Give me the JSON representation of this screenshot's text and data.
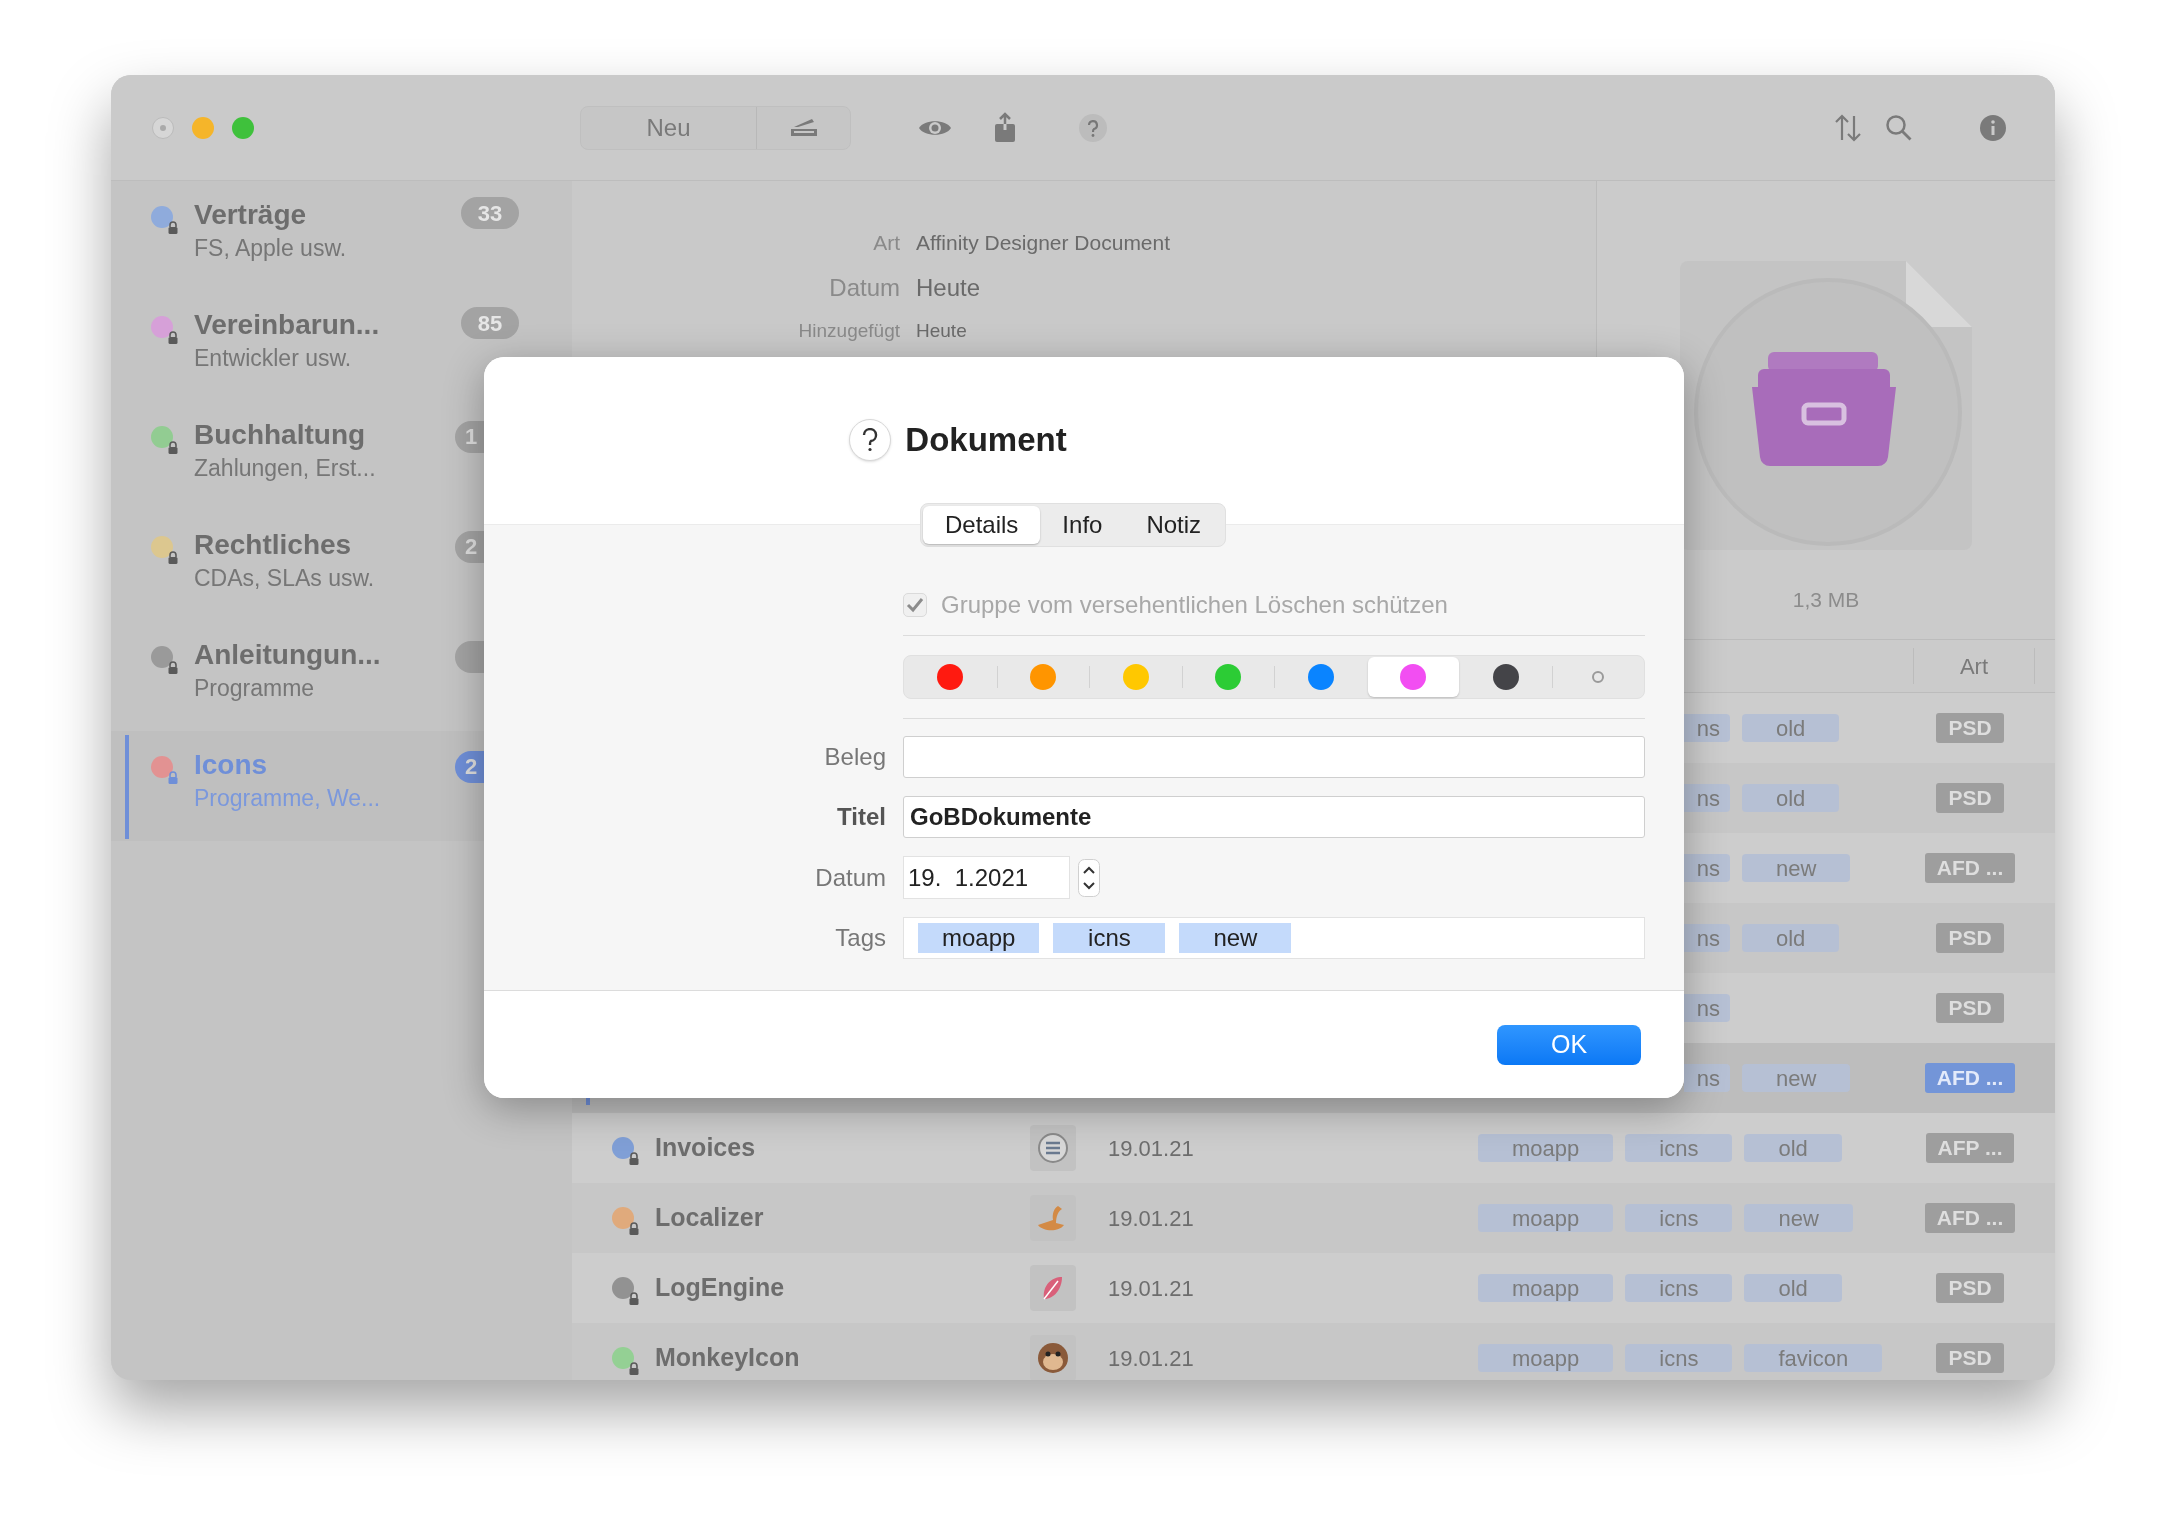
{
  "toolbar": {
    "new_button": "Neu"
  },
  "sidebar": {
    "items": [
      {
        "title": "Verträge",
        "subtitle": "FS, Apple usw.",
        "color": "#8fabdc",
        "selected": false,
        "badge": {
          "text": "33",
          "cut": false
        }
      },
      {
        "title": "Vereinbarun...",
        "subtitle": "Entwickler usw.",
        "color": "#d6a0d8",
        "selected": false,
        "badge": {
          "text": "85",
          "cut": false
        }
      },
      {
        "title": "Buchhaltung",
        "subtitle": "Zahlungen, Erst...",
        "color": "#92cc92",
        "selected": false,
        "badge": {
          "text": "1",
          "cut": true
        }
      },
      {
        "title": "Rechtliches",
        "subtitle": "CDAs, SLAs usw.",
        "color": "#dcc78f",
        "selected": false,
        "badge": {
          "text": "2",
          "cut": true
        }
      },
      {
        "title": "Anleitungun...",
        "subtitle": "Programme",
        "color": "#9a9a9a",
        "selected": false,
        "badge": {
          "cut": true
        }
      },
      {
        "title": "Icons",
        "subtitle": "Programme, We...",
        "color": "#e29292",
        "selected": true,
        "badge": {
          "text": "2",
          "cut": true
        }
      }
    ]
  },
  "details": {
    "fields": [
      {
        "label": "Art",
        "value": "Affinity Designer Document",
        "kind": "normal"
      },
      {
        "label": "Datum",
        "value": "Heute",
        "kind": "large"
      },
      {
        "label": "Hinzugefügt",
        "value": "Heute",
        "kind": "small"
      }
    ]
  },
  "preview": {
    "size": "1,3 MB"
  },
  "table": {
    "columns": [
      {
        "label": "Art"
      }
    ],
    "rows": [
      {
        "kind": "covered",
        "tags": [
          "ns",
          "old"
        ],
        "type": "PSD",
        "selected": false
      },
      {
        "kind": "covered",
        "tags": [
          "ns",
          "old"
        ],
        "type": "PSD",
        "selected": false
      },
      {
        "kind": "covered",
        "tags": [
          "ns",
          "new"
        ],
        "type": "AFD ...",
        "selected": false
      },
      {
        "kind": "covered",
        "tags": [
          "ns",
          "old"
        ],
        "type": "PSD",
        "selected": false
      },
      {
        "kind": "covered",
        "tags": [
          "ns"
        ],
        "type": "PSD",
        "selected": false
      },
      {
        "kind": "covered",
        "tags": [
          "ns",
          "new"
        ],
        "type": "AFD ...",
        "selected": true
      },
      {
        "kind": "full",
        "name": "Invoices",
        "color": "#809fd6",
        "date": "19.01.21",
        "tags": [
          "moapp",
          "icns",
          "old"
        ],
        "type": "AFP ...",
        "selected": false
      },
      {
        "kind": "full",
        "name": "Localizer",
        "color": "#e0aa7c",
        "date": "19.01.21",
        "tags": [
          "moapp",
          "icns",
          "new"
        ],
        "type": "AFD ...",
        "selected": false
      },
      {
        "kind": "full",
        "name": "LogEngine",
        "color": "#929292",
        "date": "19.01.21",
        "tags": [
          "moapp",
          "icns",
          "old"
        ],
        "type": "PSD",
        "selected": false
      },
      {
        "kind": "full",
        "name": "MonkeyIcon",
        "color": "#94d094",
        "date": "19.01.21",
        "tags": [
          "moapp",
          "icns",
          "favicon"
        ],
        "type": "PSD",
        "selected": false
      }
    ]
  },
  "dialog": {
    "title": "Dokument",
    "tabs": [
      {
        "label": "Details",
        "selected": true
      },
      {
        "label": "Info",
        "selected": false
      },
      {
        "label": "Notiz",
        "selected": false
      }
    ],
    "protect": {
      "label": "Gruppe vom versehentlichen Löschen schützen",
      "checked": true,
      "disabled": true
    },
    "colors": [
      {
        "kind": "color",
        "color": "#ff1a10",
        "selected": false
      },
      {
        "kind": "color",
        "color": "#ff9500",
        "selected": false
      },
      {
        "kind": "color",
        "color": "#ffc800",
        "selected": false
      },
      {
        "kind": "color",
        "color": "#2ccc35",
        "selected": false
      },
      {
        "kind": "color",
        "color": "#0a84ff",
        "selected": false
      },
      {
        "kind": "color",
        "color": "#f24ef2",
        "selected": true
      },
      {
        "kind": "color",
        "color": "#444448",
        "selected": false
      },
      {
        "kind": "none",
        "selected": false
      }
    ],
    "fields": [
      {
        "label": "Beleg",
        "kind": "text",
        "emphasized": false
      },
      {
        "label": "Titel",
        "kind": "text",
        "value": "GoBDokumente",
        "emphasized": true
      },
      {
        "label": "Datum",
        "kind": "date",
        "value": "19.  1.2021",
        "emphasized": false
      },
      {
        "label": "Tags",
        "kind": "tags",
        "tags": [
          "moapp",
          "icns",
          "new"
        ],
        "emphasized": false
      }
    ],
    "ok_button": "OK"
  }
}
